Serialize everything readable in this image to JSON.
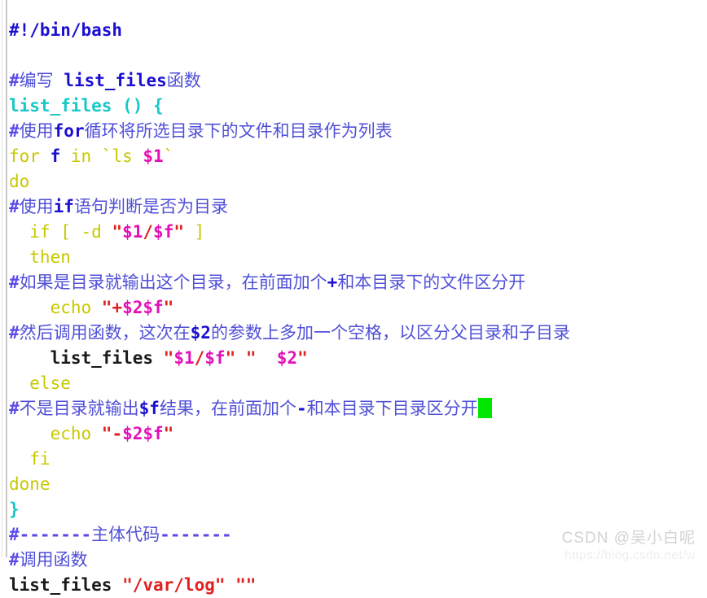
{
  "editor": {
    "language": "bash",
    "background_color": "#ffffff",
    "cursor_color": "#00e800",
    "colors": {
      "comment_hash": "#5b4ae8",
      "comment_chinese": "#5050d8",
      "comment_code": "#1b0fd1",
      "function_name": "#17c8c8",
      "keyword": "#c8c800",
      "variable": "#e211b7",
      "string": "#e02020",
      "plain_text": "#1a1a1a",
      "gutter_line": "#c8c8c8"
    }
  },
  "code_lines": [
    {
      "id": "l1",
      "tokens": [
        {
          "t": "#!/bin/bash",
          "c": "shebang"
        }
      ]
    },
    {
      "id": "l2",
      "tokens": []
    },
    {
      "id": "l3",
      "tokens": [
        {
          "t": "#",
          "c": "comment-hash"
        },
        {
          "t": "编写 ",
          "c": "comment-cn"
        },
        {
          "t": "list_files",
          "c": "comment-code"
        },
        {
          "t": "函数",
          "c": "comment-cn"
        }
      ]
    },
    {
      "id": "l4",
      "tokens": [
        {
          "t": "list_files () {",
          "c": "func"
        }
      ]
    },
    {
      "id": "l5",
      "tokens": [
        {
          "t": "#",
          "c": "comment-hash"
        },
        {
          "t": "使用",
          "c": "comment-cn"
        },
        {
          "t": "for",
          "c": "comment-code"
        },
        {
          "t": "循环将所选目录下的文件和目录作为列表",
          "c": "comment-cn"
        }
      ]
    },
    {
      "id": "l6",
      "tokens": [
        {
          "t": "for ",
          "c": "keyword"
        },
        {
          "t": "f",
          "c": "ident"
        },
        {
          "t": " in ",
          "c": "keyword"
        },
        {
          "t": "`ls ",
          "c": "keyword"
        },
        {
          "t": "$1",
          "c": "var"
        },
        {
          "t": "`",
          "c": "keyword"
        }
      ]
    },
    {
      "id": "l7",
      "tokens": [
        {
          "t": "do",
          "c": "keyword"
        }
      ]
    },
    {
      "id": "l8",
      "tokens": [
        {
          "t": "#",
          "c": "comment-hash"
        },
        {
          "t": "使用",
          "c": "comment-cn"
        },
        {
          "t": "if",
          "c": "comment-code"
        },
        {
          "t": "语句判断是否为目录",
          "c": "comment-cn"
        }
      ]
    },
    {
      "id": "l9",
      "tokens": [
        {
          "t": "  if [ -d ",
          "c": "keyword"
        },
        {
          "t": "\"",
          "c": "string"
        },
        {
          "t": "$1",
          "c": "var"
        },
        {
          "t": "/",
          "c": "string"
        },
        {
          "t": "$f",
          "c": "var"
        },
        {
          "t": "\"",
          "c": "string"
        },
        {
          "t": " ]",
          "c": "keyword"
        }
      ]
    },
    {
      "id": "l10",
      "tokens": [
        {
          "t": "  then",
          "c": "keyword"
        }
      ]
    },
    {
      "id": "l11",
      "tokens": [
        {
          "t": "#",
          "c": "comment-hash"
        },
        {
          "t": "如果是目录就输出这个目录，在前面加个",
          "c": "comment-cn"
        },
        {
          "t": "+",
          "c": "comment-code"
        },
        {
          "t": "和本目录下的文件区分开",
          "c": "comment-cn"
        }
      ]
    },
    {
      "id": "l12",
      "tokens": [
        {
          "t": "    echo ",
          "c": "keyword"
        },
        {
          "t": "\"+",
          "c": "string"
        },
        {
          "t": "$2$f",
          "c": "var"
        },
        {
          "t": "\"",
          "c": "string"
        }
      ]
    },
    {
      "id": "l13",
      "tokens": [
        {
          "t": "#",
          "c": "comment-hash"
        },
        {
          "t": "然后调用函数，这次在",
          "c": "comment-cn"
        },
        {
          "t": "$2",
          "c": "comment-code"
        },
        {
          "t": "的参数上多加一个空格，以区分父目录和子目录",
          "c": "comment-cn"
        }
      ]
    },
    {
      "id": "l14",
      "tokens": [
        {
          "t": "    list_files ",
          "c": "plain"
        },
        {
          "t": "\"",
          "c": "string"
        },
        {
          "t": "$1",
          "c": "var"
        },
        {
          "t": "/",
          "c": "string"
        },
        {
          "t": "$f",
          "c": "var"
        },
        {
          "t": "\" \"  ",
          "c": "string"
        },
        {
          "t": "$2",
          "c": "var"
        },
        {
          "t": "\"",
          "c": "string"
        }
      ]
    },
    {
      "id": "l15",
      "tokens": [
        {
          "t": "  else",
          "c": "keyword"
        }
      ]
    },
    {
      "id": "l16",
      "tokens": [
        {
          "t": "#",
          "c": "comment-hash"
        },
        {
          "t": "不是目录就输出",
          "c": "comment-cn"
        },
        {
          "t": "$f",
          "c": "comment-code"
        },
        {
          "t": "结果，在前面加个",
          "c": "comment-cn"
        },
        {
          "t": "-",
          "c": "comment-code"
        },
        {
          "t": "和本目录下目录区分开",
          "c": "comment-cn"
        }
      ],
      "cursor": true
    },
    {
      "id": "l17",
      "tokens": [
        {
          "t": "    echo ",
          "c": "keyword"
        },
        {
          "t": "\"-",
          "c": "string"
        },
        {
          "t": "$2$f",
          "c": "var"
        },
        {
          "t": "\"",
          "c": "string"
        }
      ]
    },
    {
      "id": "l18",
      "tokens": [
        {
          "t": "  fi",
          "c": "keyword"
        }
      ]
    },
    {
      "id": "l19",
      "tokens": [
        {
          "t": "done",
          "c": "keyword"
        }
      ]
    },
    {
      "id": "l20",
      "tokens": [
        {
          "t": "}",
          "c": "brace"
        }
      ]
    },
    {
      "id": "l21",
      "tokens": [
        {
          "t": "#-------",
          "c": "comment-hash"
        },
        {
          "t": "主体代码",
          "c": "comment-cn"
        },
        {
          "t": "-------",
          "c": "comment-hash"
        }
      ]
    },
    {
      "id": "l22",
      "tokens": [
        {
          "t": "#",
          "c": "comment-hash"
        },
        {
          "t": "调用函数",
          "c": "comment-cn"
        }
      ]
    },
    {
      "id": "l23",
      "tokens": [
        {
          "t": "list_files ",
          "c": "plain"
        },
        {
          "t": "\"/var/log\" \"\"",
          "c": "string"
        }
      ]
    }
  ],
  "watermark": {
    "text": "CSDN @吴小白呢",
    "url": "https://blog.csdn.net/w"
  }
}
